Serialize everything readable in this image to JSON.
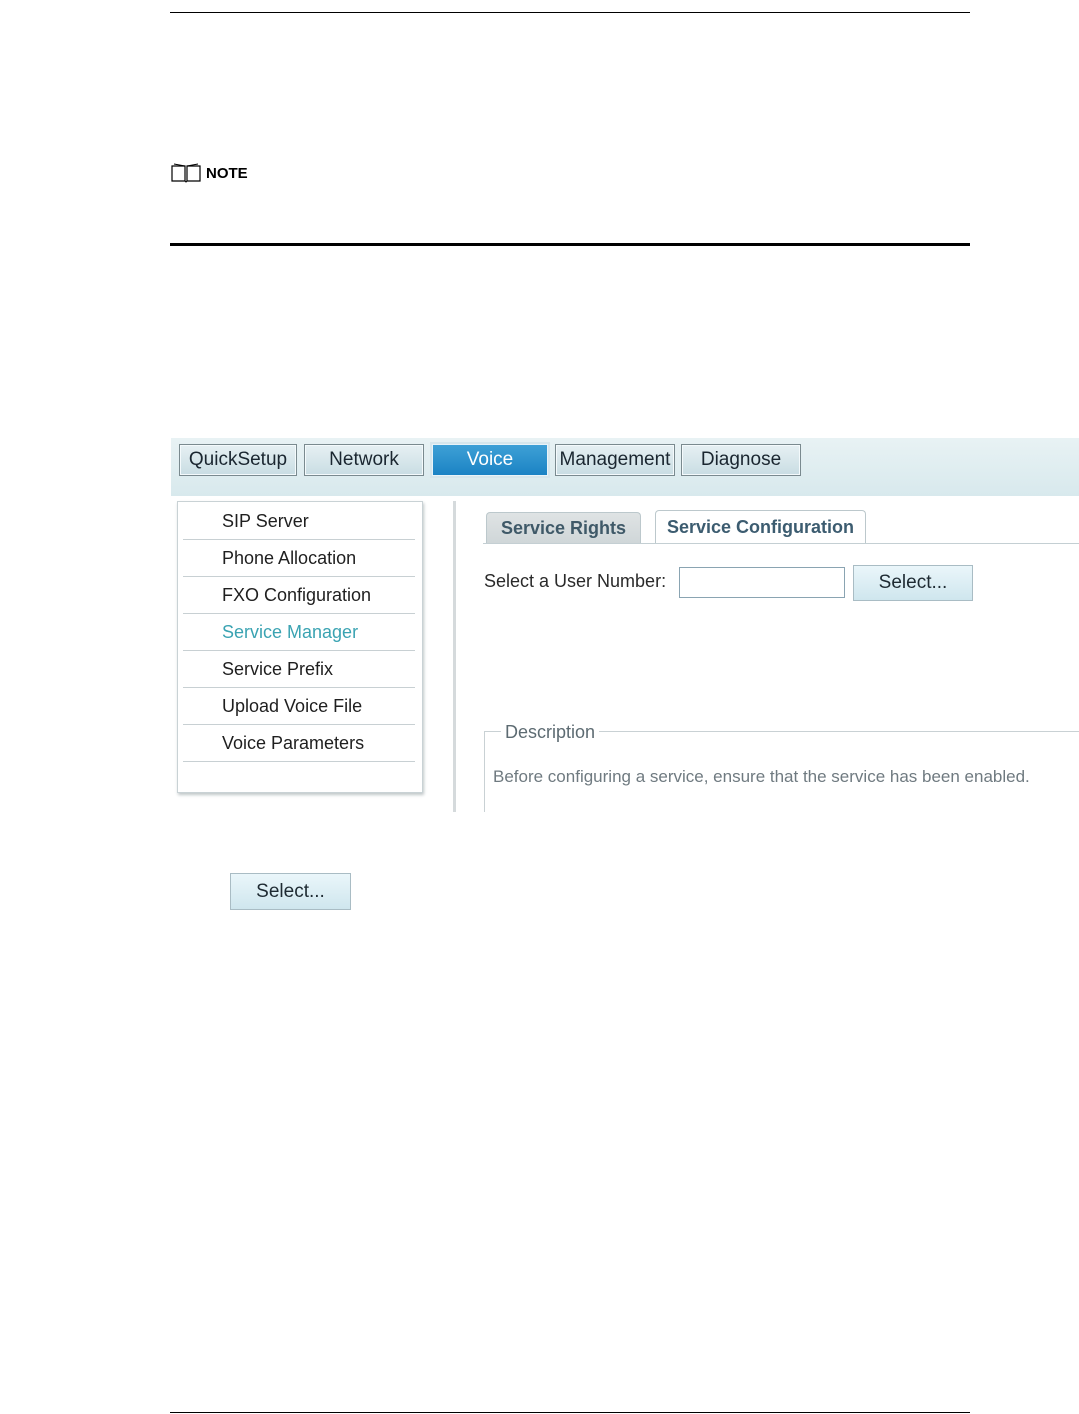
{
  "note": {
    "label": "NOTE",
    "icon": "book-icon"
  },
  "menubar": {
    "tabs": [
      {
        "label": "QuickSetup"
      },
      {
        "label": "Network"
      },
      {
        "label": "Voice"
      },
      {
        "label": "Management"
      },
      {
        "label": "Diagnose"
      }
    ],
    "active": "Voice"
  },
  "sidebar": {
    "items": [
      {
        "label": "SIP Server"
      },
      {
        "label": "Phone Allocation"
      },
      {
        "label": "FXO Configuration"
      },
      {
        "label": "Service Manager"
      },
      {
        "label": "Service Prefix"
      },
      {
        "label": "Upload Voice File"
      },
      {
        "label": "Voice Parameters"
      }
    ],
    "active": "Service Manager"
  },
  "content": {
    "tabs": [
      {
        "label": "Service Rights"
      },
      {
        "label": "Service Configuration"
      }
    ],
    "active_tab": "Service Configuration",
    "user_number_label": "Select a User Number:",
    "user_number_value": "",
    "select_button": "Select...",
    "description_legend": "Description",
    "description_text": "Before configuring a service, ensure that the service has been enabled."
  },
  "standalone_button": "Select...",
  "colors": {
    "active_menu_tab": "#1b83c4",
    "active_sidebar_text": "#3aa3b2",
    "menubar_bg": "#d8e9ed"
  }
}
